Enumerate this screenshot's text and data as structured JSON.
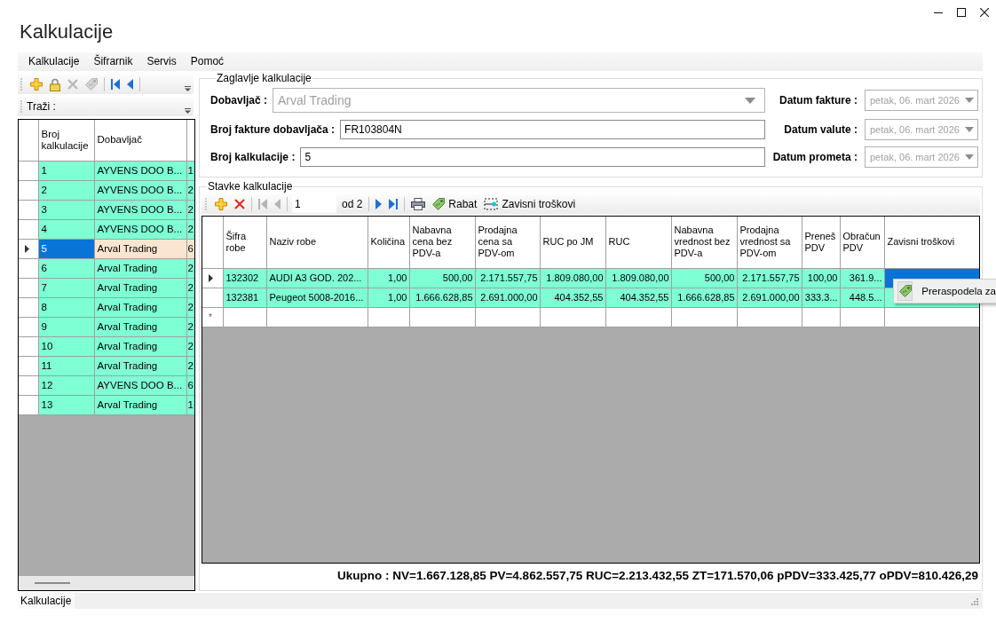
{
  "window": {
    "title": "Kalkulacije"
  },
  "menu_bar": [
    "Kalkulacije",
    "Šifrarnik",
    "Servis",
    "Pomoć"
  ],
  "list_panel": {
    "toolbar": [
      {
        "kind": "add",
        "disabled": false
      },
      {
        "kind": "lock",
        "disabled": false
      },
      {
        "kind": "delete",
        "disabled": true
      },
      {
        "kind": "tag",
        "disabled": true
      },
      {
        "kind": "separator"
      },
      {
        "kind": "first",
        "disabled": false
      },
      {
        "kind": "previous",
        "disabled": false
      },
      {
        "kind": "separator"
      }
    ],
    "search_label": "Traži :",
    "table": {
      "columns": [
        "Broj kalkulacije",
        "Dobavljač"
      ],
      "rows": [
        {
          "selected": false,
          "cells": [
            "1",
            "AYVENS DOO B...",
            "1"
          ]
        },
        {
          "selected": false,
          "cells": [
            "2",
            "AYVENS DOO B...",
            "2"
          ]
        },
        {
          "selected": false,
          "cells": [
            "3",
            "AYVENS DOO B...",
            "2"
          ]
        },
        {
          "selected": false,
          "cells": [
            "4",
            "AYVENS DOO B...",
            "2"
          ]
        },
        {
          "selected": true,
          "cells": [
            "5",
            "Arval Trading",
            "6"
          ]
        },
        {
          "selected": false,
          "cells": [
            "6",
            "Arval Trading",
            "2"
          ]
        },
        {
          "selected": false,
          "cells": [
            "7",
            "Arval Trading",
            "2"
          ]
        },
        {
          "selected": false,
          "cells": [
            "8",
            "Arval Trading",
            "2"
          ]
        },
        {
          "selected": false,
          "cells": [
            "9",
            "Arval Trading",
            "2"
          ]
        },
        {
          "selected": false,
          "cells": [
            "10",
            "Arval Trading",
            "2"
          ]
        },
        {
          "selected": false,
          "cells": [
            "11",
            "Arval Trading",
            "2"
          ]
        },
        {
          "selected": false,
          "cells": [
            "12",
            "AYVENS DOO B...",
            "6"
          ]
        },
        {
          "selected": false,
          "cells": [
            "13",
            "Arval Trading",
            "1"
          ]
        }
      ]
    }
  },
  "header_group": {
    "title": "Zaglavlje kalkulacije",
    "fields": [
      {
        "kind": "combo",
        "label": "Dobavljač :",
        "value": "Arval Trading",
        "disabled": true
      },
      {
        "kind": "text",
        "label": "Broj fakture dobavljača :",
        "value": "FR103804N"
      },
      {
        "kind": "text",
        "label": "Broj kalkulacije :",
        "value": "5"
      }
    ],
    "dates": [
      {
        "label": "Datum fakture :",
        "value": "petak, 06. mart 2026",
        "disabled": true
      },
      {
        "label": "Datum valute :",
        "value": "petak, 06. mart 2026",
        "disabled": true
      },
      {
        "label": "Datum prometa :",
        "value": "petak, 06. mart 2026",
        "disabled": true
      }
    ]
  },
  "items_group": {
    "title": "Stavke kalkulacije",
    "toolbar": [
      {
        "kind": "add",
        "disabled": false
      },
      {
        "kind": "delete",
        "disabled": false
      },
      {
        "kind": "separator"
      },
      {
        "kind": "first",
        "disabled": true
      },
      {
        "kind": "previous",
        "disabled": true
      },
      {
        "kind": "separator"
      },
      {
        "kind": "position",
        "value": "1"
      },
      {
        "kind": "count",
        "text": "od 2"
      },
      {
        "kind": "separator"
      },
      {
        "kind": "next",
        "disabled": false
      },
      {
        "kind": "last",
        "disabled": false
      },
      {
        "kind": "separator"
      },
      {
        "kind": "print",
        "disabled": false
      },
      {
        "kind": "tag",
        "label": "Rabat",
        "disabled": false
      },
      {
        "kind": "costs",
        "label": "Zavisni troškovi",
        "disabled": false
      }
    ],
    "table": {
      "columns": [
        "Šifra robe",
        "Naziv robe",
        "Količina",
        "Nabavna cena bez PDV-a",
        "Prodajna cena sa PDV-om",
        "RUC po JM",
        "RUC",
        "Nabavna vrednost bez PDV-a",
        "Prodajna vrednost sa PDV-om",
        "Preneš PDV",
        "Obračun PDV",
        "Zavisni troškovi"
      ],
      "rows": [
        {
          "selected": true,
          "cost_cell_selected": true,
          "cells": [
            "132302",
            "AUDI A3 GOD. 202...",
            "1,00",
            "500,00",
            "2.171.557,75",
            "1.809.080,00",
            "1.809.080,00",
            "500,00",
            "2.171.557,75",
            "100,00",
            "361.9..."
          ]
        },
        {
          "selected": false,
          "cost_cell_selected": false,
          "cells": [
            "132381",
            "Peugeot 5008-2016...",
            "1,00",
            "1.666.628,85",
            "2.691.000,00",
            "404.352,55",
            "404.352,55",
            "1.666.628,85",
            "2.691.000,00",
            "333.3...",
            "448.5..."
          ]
        }
      ],
      "new_row_marker": "*"
    },
    "totals": "Ukupno : NV=1.667.128,85 PV=4.862.557,75 RUC=2.213.432,55 ZT=171.570,06 pPDV=333.425,77 oPDV=810.426,29"
  },
  "context_menu": {
    "items": [
      {
        "label": "Preraspodela za"
      }
    ]
  },
  "status_bar": {
    "text": "Kalkulacije"
  }
}
